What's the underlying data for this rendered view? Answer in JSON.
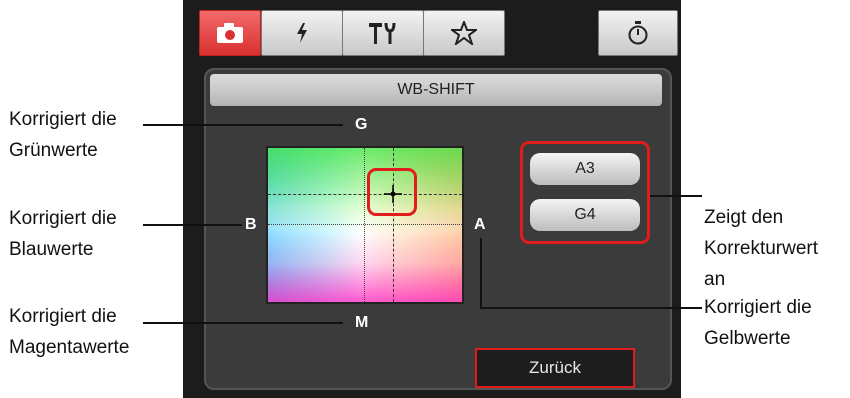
{
  "tabs": [
    {
      "name": "camera-icon",
      "active": true
    },
    {
      "name": "flash-icon",
      "active": false
    },
    {
      "name": "tools-icon",
      "active": false
    },
    {
      "name": "star-icon",
      "active": false
    },
    {
      "name": "timer-icon",
      "active": false
    }
  ],
  "wb": {
    "title": "WB-SHIFT",
    "axis": {
      "top": "G",
      "left": "B",
      "right": "A",
      "bottom": "M"
    },
    "values": [
      "A3",
      "G4"
    ],
    "back_label": "Zurück"
  },
  "callouts": {
    "green_1": "Korrigiert die",
    "green_2": "Grünwerte",
    "blue_1": "Korrigiert die",
    "blue_2": "Blauwerte",
    "magenta_1": "Korrigiert die",
    "magenta_2": "Magentawerte",
    "value_1": "Zeigt den",
    "value_2": "Korrekturwert",
    "value_3": "an",
    "yellow_1": "Korrigiert die",
    "yellow_2": "Gelbwerte"
  },
  "colors": {
    "highlight": "#e01c1c",
    "panel": "#1c1c1c"
  }
}
